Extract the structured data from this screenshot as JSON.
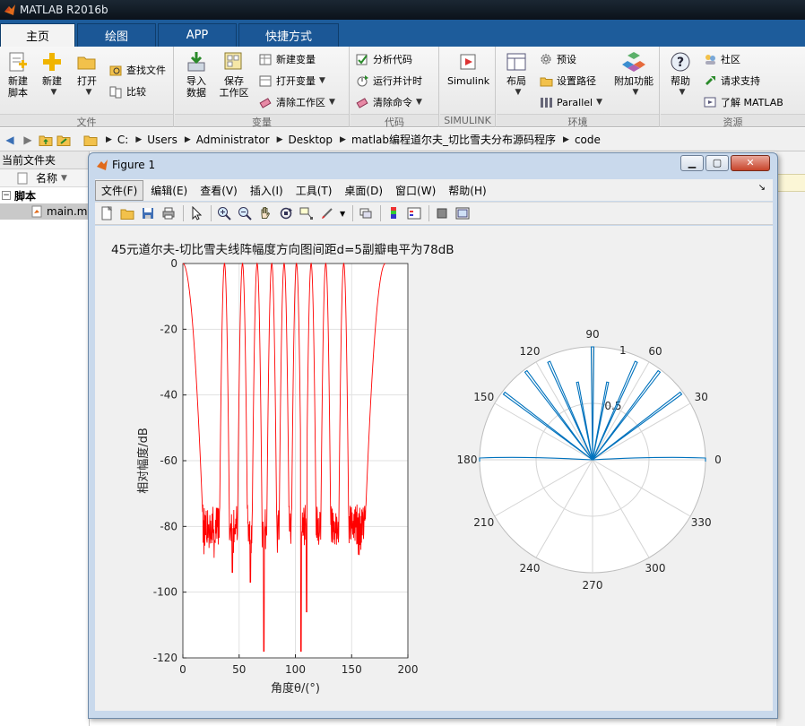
{
  "app": {
    "title": "MATLAB R2016b"
  },
  "tabs": [
    {
      "label": "主页",
      "active": true
    },
    {
      "label": "绘图",
      "active": false
    },
    {
      "label": "APP",
      "active": false
    },
    {
      "label": "快捷方式",
      "active": false
    }
  ],
  "ribbon": {
    "file": {
      "label": "文件",
      "new_script": "新建\n脚本",
      "new": "新建",
      "open": "打开",
      "find_files": "查找文件",
      "compare": "比较"
    },
    "variable": {
      "label": "变量",
      "import": "导入\n数据",
      "save_ws": "保存\n工作区",
      "new_var": "新建变量",
      "open_var": "打开变量",
      "clear_ws": "清除工作区"
    },
    "code": {
      "label": "代码",
      "analyze": "分析代码",
      "run_time": "运行并计时",
      "clear_cmd": "清除命令"
    },
    "simulink": {
      "label": "SIMULINK",
      "btn": "Simulink"
    },
    "env": {
      "label": "环境",
      "layout": "布局",
      "prefs": "预设",
      "set_path": "设置路径",
      "parallel": "Parallel",
      "addons": "附加功能"
    },
    "resources": {
      "label": "资源",
      "help": "帮助",
      "community": "社区",
      "support": "请求支持",
      "learn": "了解 MATLAB"
    }
  },
  "address": {
    "crumbs": [
      "C:",
      "Users",
      "Administrator",
      "Desktop",
      "matlab编程道尔夫_切比雪夫分布源码程序",
      "code"
    ]
  },
  "left_panel": {
    "title": "当前文件夹",
    "column": "名称",
    "group": "脚本",
    "file": "main.m"
  },
  "figure": {
    "title": "Figure 1",
    "menus": [
      "文件(F)",
      "编辑(E)",
      "查看(V)",
      "插入(I)",
      "工具(T)",
      "桌面(D)",
      "窗口(W)",
      "帮助(H)"
    ],
    "toolbar_icons": [
      "new-figure-icon",
      "open-file-icon",
      "save-icon",
      "print-icon",
      "pointer-icon",
      "zoom-in-icon",
      "zoom-out-icon",
      "pan-icon",
      "rotate-icon",
      "data-cursor-icon",
      "brush-icon",
      "link-plot-icon",
      "colorbar-icon",
      "legend-icon",
      "hide-plot-tools-icon",
      "show-plot-tools-icon"
    ]
  },
  "chart_data": [
    {
      "type": "line",
      "title": "45元道尔夫-切比雪夫线阵幅度方向图间距d=5副瓣电平为78dB",
      "xlabel": "角度θ/(°)",
      "ylabel": "相对幅度/dB",
      "xlim": [
        0,
        200
      ],
      "ylim": [
        -120,
        0
      ],
      "xticks": [
        0,
        50,
        100,
        150,
        200
      ],
      "yticks": [
        0,
        -20,
        -40,
        -60,
        -80,
        -100,
        -120
      ],
      "grid": true,
      "color": "#ff0000",
      "main_lobes_deg": [
        0,
        37,
        53,
        66,
        79,
        90,
        101,
        114,
        127,
        143,
        180
      ],
      "sidelobe_level_db": -78,
      "deep_nulls": [
        [
          72,
          -118
        ],
        [
          105,
          -118
        ],
        [
          110,
          -106
        ],
        [
          44,
          -94
        ],
        [
          60,
          -97
        ]
      ]
    },
    {
      "type": "polar",
      "theta_ticks": [
        "0",
        "30",
        "60",
        "90",
        "120",
        "150",
        "180",
        "210",
        "240",
        "270",
        "300",
        "330"
      ],
      "r_ticks": [
        "0.5",
        "1"
      ],
      "color": "#0072bd",
      "lobes": [
        {
          "theta": 0,
          "r": 1.0
        },
        {
          "theta": 37,
          "r": 0.98
        },
        {
          "theta": 53,
          "r": 0.98
        },
        {
          "theta": 66,
          "r": 0.95
        },
        {
          "theta": 79,
          "r": 0.7
        },
        {
          "theta": 90,
          "r": 1.0
        },
        {
          "theta": 101,
          "r": 0.7
        },
        {
          "theta": 114,
          "r": 0.95
        },
        {
          "theta": 127,
          "r": 0.98
        },
        {
          "theta": 143,
          "r": 0.98
        },
        {
          "theta": 180,
          "r": 1.0
        }
      ]
    }
  ]
}
